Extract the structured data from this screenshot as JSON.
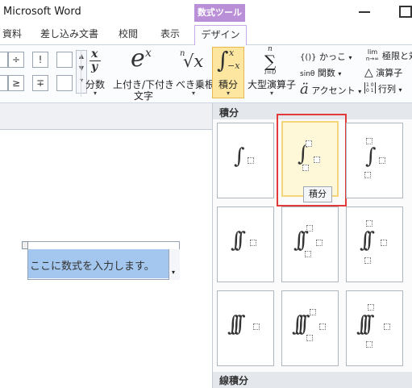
{
  "window": {
    "title": "Microsoft Word",
    "context_tab_group": "数式ツール"
  },
  "tabs": [
    {
      "label": "資料"
    },
    {
      "label": "差し込み文書"
    },
    {
      "label": "校閲"
    },
    {
      "label": "表示"
    },
    {
      "label": "デザイン",
      "active": true
    }
  ],
  "symbols": [
    "÷",
    "!",
    "≥",
    "∓"
  ],
  "ribbon": {
    "fraction": {
      "glyph_top": "x",
      "glyph_bottom": "y",
      "label": "分数"
    },
    "script": {
      "glyph": "e",
      "sup": "x",
      "label1": "上付き/下付き",
      "label2": "文字"
    },
    "radical": {
      "glyph": "√x",
      "index": "n",
      "label": "べき乗根"
    },
    "integral": {
      "glyph": "∫",
      "upper": "x",
      "lower": "−x",
      "label": "積分"
    },
    "large_operator": {
      "glyph": "∑",
      "upper": "n",
      "lower": "i=0",
      "label": "大型演算子"
    },
    "brackets": {
      "glyph": "{()}",
      "label": "かっこ"
    },
    "function": {
      "glyph": "sinθ",
      "label": "関数"
    },
    "accent": {
      "glyph": "ä",
      "label": "アクセント"
    },
    "limit": {
      "glyph_top": "lim",
      "glyph_bottom": "n→∞",
      "label": "極限と対"
    },
    "operator": {
      "glyph": "△",
      "label": "演算子"
    },
    "matrix": {
      "glyph": "[1 0 / 0 1]",
      "label": "行列"
    },
    "dropdown_marker": "▾"
  },
  "gallery": {
    "section1": "積分",
    "section2": "線積分",
    "tooltip": "積分"
  },
  "document": {
    "equation_placeholder": "ここに数式を入力します。"
  },
  "colors": {
    "accent_purple": "#b98fd8",
    "highlight_yellow": "#fde7a0",
    "selection_blue": "#a3c7ee",
    "red_outline": "#e23a3a"
  }
}
